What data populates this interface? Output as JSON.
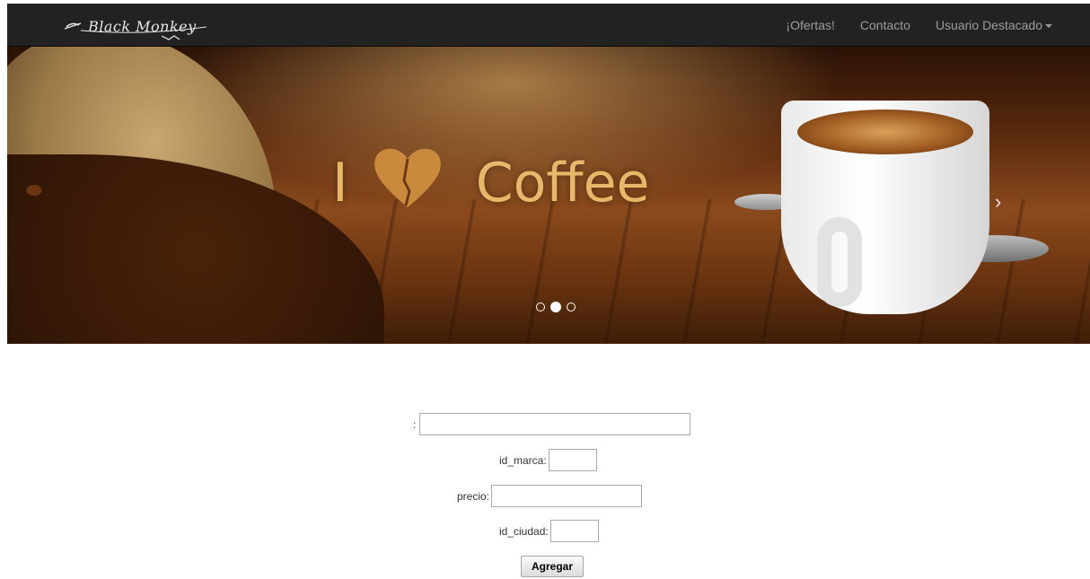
{
  "navbar": {
    "brand": "Black Monkey",
    "items": [
      {
        "label": "¡Ofertas!"
      },
      {
        "label": "Contacto"
      },
      {
        "label": "Usuario Destacado"
      }
    ]
  },
  "carousel": {
    "headline_i": "I",
    "headline_word": "Coffee",
    "next_arrow": "›",
    "active_indicator": 2,
    "indicator_count": 3
  },
  "form": {
    "field1_label": ":",
    "field1_value": "",
    "id_marca_label": "id_marca:",
    "id_marca_value": "",
    "precio_label": "precio:",
    "precio_value": "",
    "id_ciudad_label": "id_ciudad:",
    "id_ciudad_value": "",
    "submit_label": "Agregar"
  },
  "colors": {
    "navbar_bg": "#222222",
    "nav_text": "#9d9d9d",
    "headline": "#e8b86a"
  }
}
